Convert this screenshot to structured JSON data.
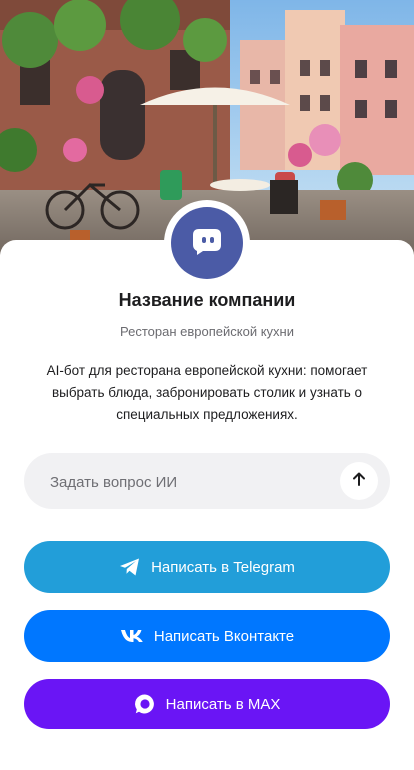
{
  "company": {
    "name": "Название компании",
    "subtitle": "Ресторан европейской кухни",
    "description": "AI-бот для ресторана европейской кухни: помогает выбрать блюда, забронировать столик и узнать о специальных предложениях."
  },
  "ask": {
    "placeholder": "Задать вопрос ИИ",
    "value": ""
  },
  "buttons": {
    "telegram": "Написать в Telegram",
    "vk": "Написать Вконтакте",
    "max": "Написать в MAX"
  },
  "icons": {
    "avatar": "chat-bot-icon",
    "send": "arrow-up-icon",
    "telegram": "telegram-icon",
    "vk": "vk-icon",
    "max": "max-icon"
  },
  "colors": {
    "avatar": "#4b5ba6",
    "telegram": "#229ed9",
    "vk": "#0077ff",
    "max": "#6a15f5",
    "input_bg": "#f1f1f3"
  }
}
